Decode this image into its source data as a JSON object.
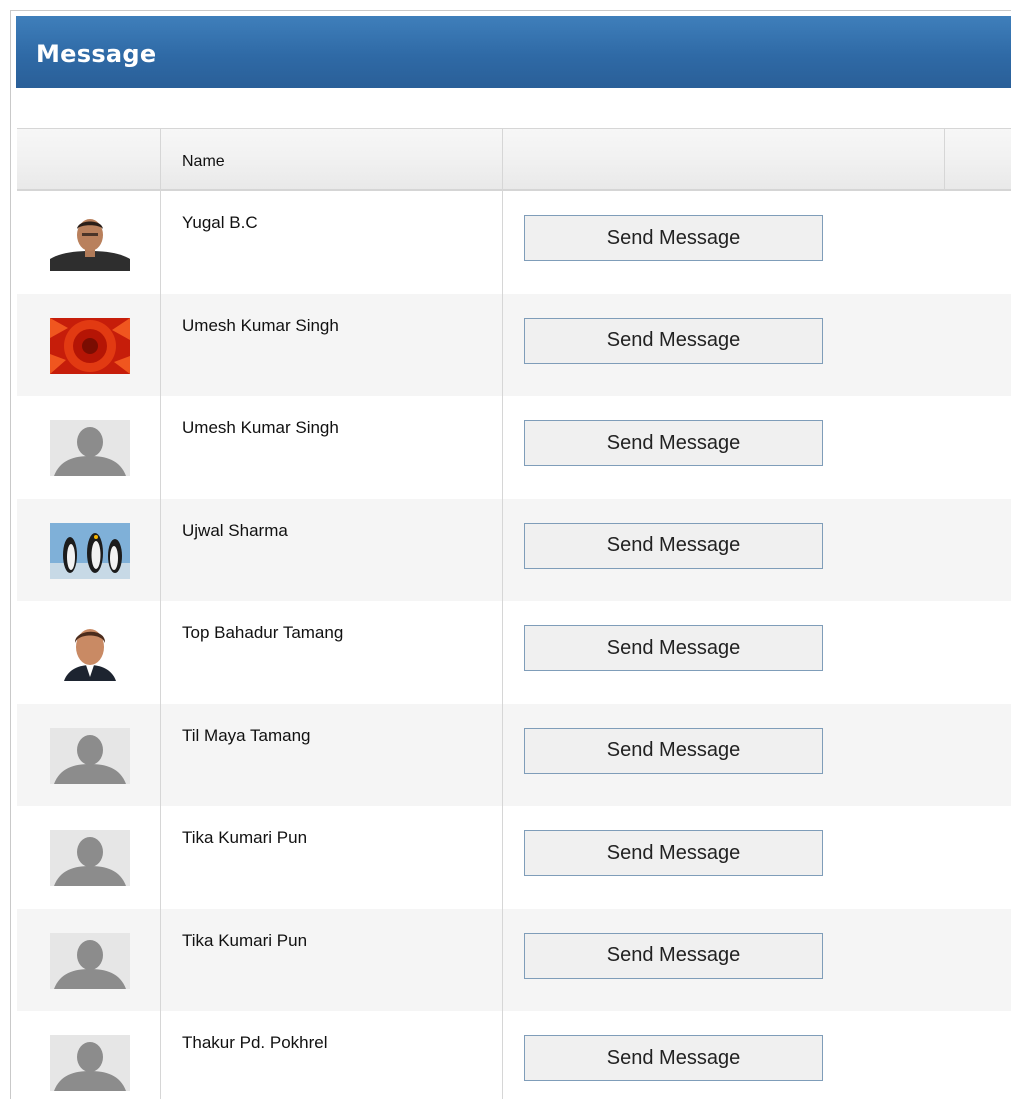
{
  "panel": {
    "title": "Message"
  },
  "grid": {
    "columns": {
      "photo": "",
      "name": "Name",
      "action": ""
    },
    "rows": [
      {
        "name": "Yugal B.C",
        "avatar": "person-photo-man-suit",
        "action_label": "Send Message"
      },
      {
        "name": "Umesh Kumar Singh",
        "avatar": "red-flower-photo",
        "action_label": "Send Message"
      },
      {
        "name": "Umesh Kumar Singh",
        "avatar": "default-user-silhouette",
        "action_label": "Send Message"
      },
      {
        "name": "Ujwal Sharma",
        "avatar": "penguins-photo",
        "action_label": "Send Message"
      },
      {
        "name": "Top Bahadur Tamang",
        "avatar": "person-photo-man-portrait",
        "action_label": "Send Message"
      },
      {
        "name": "Til Maya Tamang",
        "avatar": "default-user-silhouette",
        "action_label": "Send Message"
      },
      {
        "name": "Tika Kumari Pun",
        "avatar": "default-user-silhouette",
        "action_label": "Send Message"
      },
      {
        "name": "Tika Kumari Pun",
        "avatar": "default-user-silhouette",
        "action_label": "Send Message"
      },
      {
        "name": "Thakur Pd. Pokhrel",
        "avatar": "default-user-silhouette",
        "action_label": "Send Message"
      }
    ]
  },
  "colors": {
    "header_blue": "#2f6aa6",
    "row_alt": "#f5f5f5",
    "button_border": "#7f9db9"
  }
}
